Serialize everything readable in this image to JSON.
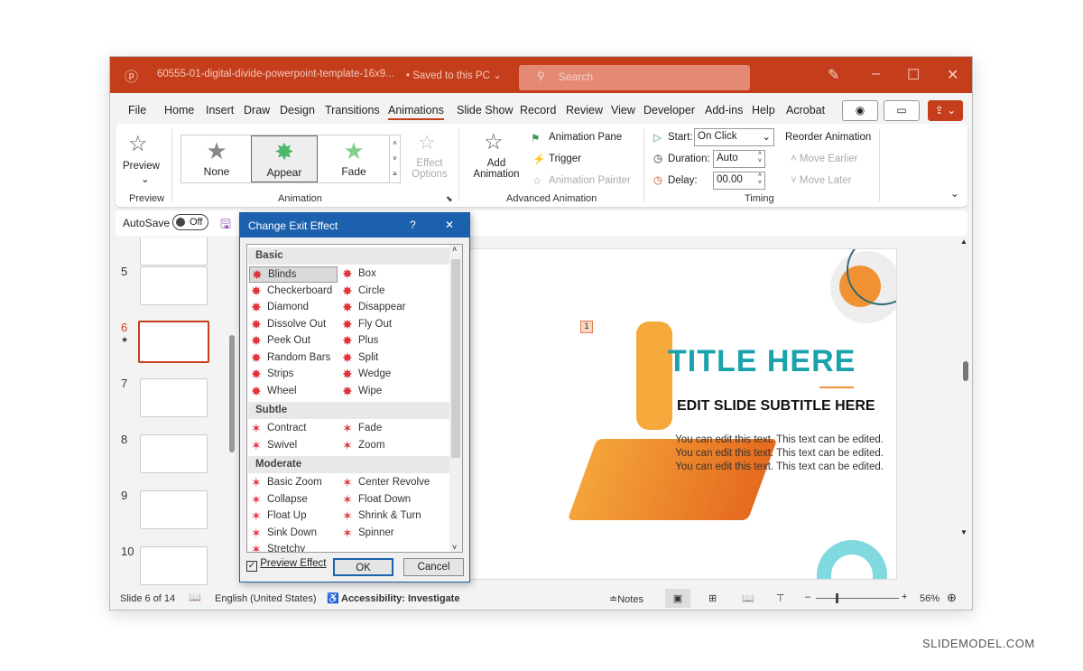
{
  "window": {
    "doc_title": "60555-01-digital-divide-powerpoint-template-16x9...",
    "save_status": "• Saved to this PC ⌄",
    "search_placeholder": "Search",
    "accent": "#c43e1c"
  },
  "tabs": [
    "File",
    "Home",
    "Insert",
    "Draw",
    "Design",
    "Transitions",
    "Animations",
    "Slide Show",
    "Record",
    "Review",
    "View",
    "Developer",
    "Add-ins",
    "Help",
    "Acrobat"
  ],
  "active_tab": "Animations",
  "ribbon": {
    "preview": {
      "label": "Preview",
      "group": "Preview"
    },
    "gallery": [
      {
        "label": "None"
      },
      {
        "label": "Appear"
      },
      {
        "label": "Fade"
      }
    ],
    "effect_options": "Effect Options",
    "animation_group": "Animation",
    "add_animation": "Add Animation",
    "animation_pane": "Animation Pane",
    "trigger": "Trigger",
    "animation_painter": "Animation Painter",
    "advanced_group": "Advanced Animation",
    "start_label": "Start:",
    "start_value": "On Click",
    "duration_label": "Duration:",
    "duration_value": "Auto",
    "delay_label": "Delay:",
    "delay_value": "00.00",
    "timing_group": "Timing",
    "reorder": "Reorder Animation",
    "move_earlier": "Move Earlier",
    "move_later": "Move Later"
  },
  "autosave": {
    "label": "AutoSave",
    "state": "Off"
  },
  "thumbnails": [
    {
      "num": "5"
    },
    {
      "num": "6",
      "star": "★",
      "selected": true
    },
    {
      "num": "7"
    },
    {
      "num": "8"
    },
    {
      "num": "9"
    },
    {
      "num": "10"
    }
  ],
  "slide": {
    "title": "TITLE HERE",
    "subtitle": "EDIT SLIDE SUBTITLE HERE",
    "body": "You can edit this text. This text can be edited. You can edit this text. This text can be edited. You can edit this text. This text can be edited.",
    "tag": "1"
  },
  "dialog": {
    "title": "Change Exit Effect",
    "help": "?",
    "close": "✕",
    "categories": [
      {
        "name": "Basic",
        "effects": [
          "Blinds",
          "Box",
          "Checkerboard",
          "Circle",
          "Diamond",
          "Disappear",
          "Dissolve Out",
          "Fly Out",
          "Peek Out",
          "Plus",
          "Random Bars",
          "Split",
          "Strips",
          "Wedge",
          "Wheel",
          "Wipe"
        ]
      },
      {
        "name": "Subtle",
        "effects": [
          "Contract",
          "Fade",
          "Swivel",
          "Zoom"
        ]
      },
      {
        "name": "Moderate",
        "effects": [
          "Basic Zoom",
          "Center Revolve",
          "Collapse",
          "Float Down",
          "Float Up",
          "Shrink & Turn",
          "Sink Down",
          "Spinner",
          "Stretchy"
        ]
      }
    ],
    "selected": "Blinds",
    "preview_effect": "Preview Effect",
    "preview_checked": true,
    "ok": "OK",
    "cancel": "Cancel"
  },
  "status": {
    "slide": "Slide 6 of 14",
    "language": "English (United States)",
    "accessibility": "Accessibility: Investigate",
    "notes": "Notes",
    "zoom": "56%",
    "zoom_level": 56
  },
  "watermark": "SLIDEMODEL.COM"
}
